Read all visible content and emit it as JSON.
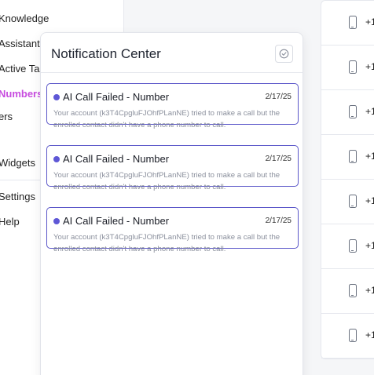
{
  "sidebar": {
    "items": [
      {
        "label": "Knowledge"
      },
      {
        "label": "Assistants"
      },
      {
        "label": "Active Tags"
      },
      {
        "label": "Numbers",
        "active": true
      },
      {
        "label": "ers"
      },
      {
        "label": "Widgets"
      },
      {
        "label": "Settings"
      },
      {
        "label": "Help"
      }
    ],
    "active_color": "#c74bdf"
  },
  "notification_center": {
    "title": "Notification Center",
    "mark_all_icon": "check-circle-icon",
    "notifications": [
      {
        "title": "AI Call Failed - Number",
        "date": "2/17/25",
        "body": "Your account (k3T4CpgluFJOhfPLanNE) tried to make a call but the enrolled contact didn't have a phone number to call."
      },
      {
        "title": "AI Call Failed - Number",
        "date": "2/17/25",
        "body": "Your account (k3T4CpgluFJOhfPLanNE) tried to make a call but the enrolled contact didn't have a phone number to call."
      },
      {
        "title": "AI Call Failed - Number",
        "date": "2/17/25",
        "body": "Your account (k3T4CpgluFJOhfPLanNE) tried to make a call but the enrolled contact didn't have a phone number to call."
      }
    ],
    "unread_color": "#5e57d6",
    "border_color": "#5b57c9"
  },
  "phone_list": {
    "icon": "mobile-phone-icon",
    "rows": [
      {
        "text": "+1"
      },
      {
        "text": "+1"
      },
      {
        "text": "+1"
      },
      {
        "text": "+1"
      },
      {
        "text": "+1"
      },
      {
        "text": "+1"
      },
      {
        "text": "+1"
      },
      {
        "text": "+1"
      }
    ]
  }
}
